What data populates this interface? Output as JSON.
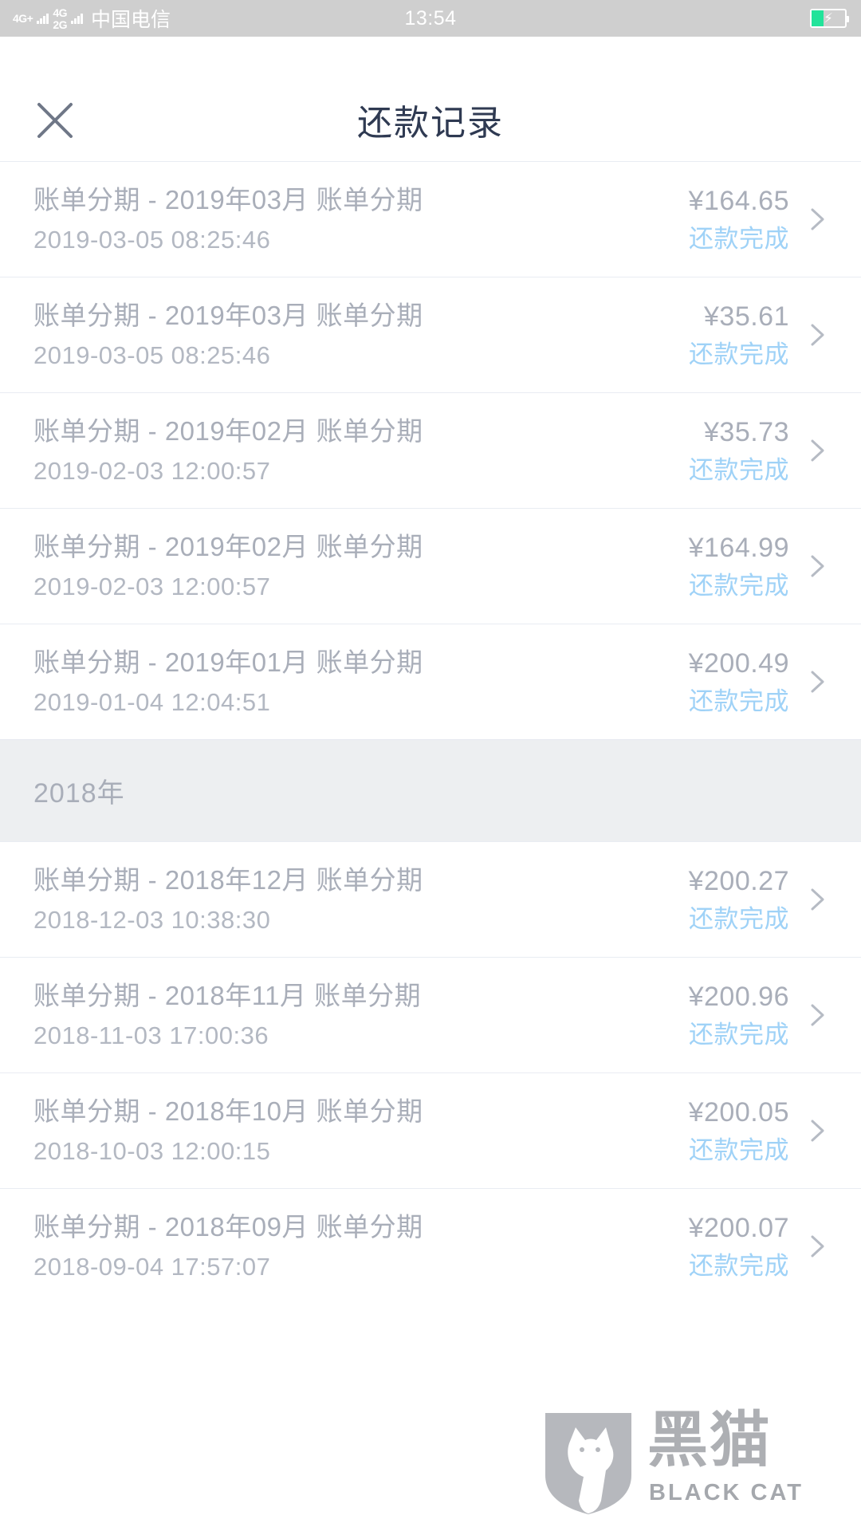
{
  "status_bar": {
    "network_top": "4G+",
    "network_second": "4G",
    "network_third": "2G",
    "carrier": "中国电信",
    "time": "13:54",
    "battery_level_percent": 36,
    "battery_charging": true,
    "battery_fill_color": "#22e39a",
    "background_color": "#cfcfcf"
  },
  "header": {
    "close_icon": "close-icon",
    "title": "还款记录",
    "title_color": "#2f3a52"
  },
  "theme": {
    "row_text_color": "#a9aeb9",
    "row_date_color": "#b3b8c2",
    "status_color": "#9fd2f7",
    "section_bg_color": "#edeff1",
    "divider_color": "#e9ecf2"
  },
  "list": [
    {
      "kind": "record",
      "title": "账单分期 - 2019年03月 账单分期",
      "date": "2019-03-05 08:25:46",
      "amount": "¥164.65",
      "status": "还款完成",
      "chevron": "chevron-right-icon"
    },
    {
      "kind": "record",
      "title": "账单分期 - 2019年03月 账单分期",
      "date": "2019-03-05 08:25:46",
      "amount": "¥35.61",
      "status": "还款完成",
      "chevron": "chevron-right-icon"
    },
    {
      "kind": "record",
      "title": "账单分期 - 2019年02月 账单分期",
      "date": "2019-02-03 12:00:57",
      "amount": "¥35.73",
      "status": "还款完成",
      "chevron": "chevron-right-icon"
    },
    {
      "kind": "record",
      "title": "账单分期 - 2019年02月 账单分期",
      "date": "2019-02-03 12:00:57",
      "amount": "¥164.99",
      "status": "还款完成",
      "chevron": "chevron-right-icon"
    },
    {
      "kind": "record",
      "title": "账单分期 - 2019年01月 账单分期",
      "date": "2019-01-04 12:04:51",
      "amount": "¥200.49",
      "status": "还款完成",
      "chevron": "chevron-right-icon"
    },
    {
      "kind": "section",
      "label": "2018年"
    },
    {
      "kind": "record",
      "title": "账单分期 - 2018年12月 账单分期",
      "date": "2018-12-03 10:38:30",
      "amount": "¥200.27",
      "status": "还款完成",
      "chevron": "chevron-right-icon"
    },
    {
      "kind": "record",
      "title": "账单分期 - 2018年11月 账单分期",
      "date": "2018-11-03 17:00:36",
      "amount": "¥200.96",
      "status": "还款完成",
      "chevron": "chevron-right-icon"
    },
    {
      "kind": "record",
      "title": "账单分期 - 2018年10月 账单分期",
      "date": "2018-10-03 12:00:15",
      "amount": "¥200.05",
      "status": "还款完成",
      "chevron": "chevron-right-icon"
    },
    {
      "kind": "record",
      "title": "账单分期 - 2018年09月 账单分期",
      "date": "2018-09-04 17:57:07",
      "amount": "¥200.07",
      "status": "还款完成",
      "chevron": "chevron-right-icon"
    }
  ],
  "watermark": {
    "cn_text": "黑猫",
    "en_text": "BLACK CAT",
    "icon": "black-cat-shield-logo"
  }
}
